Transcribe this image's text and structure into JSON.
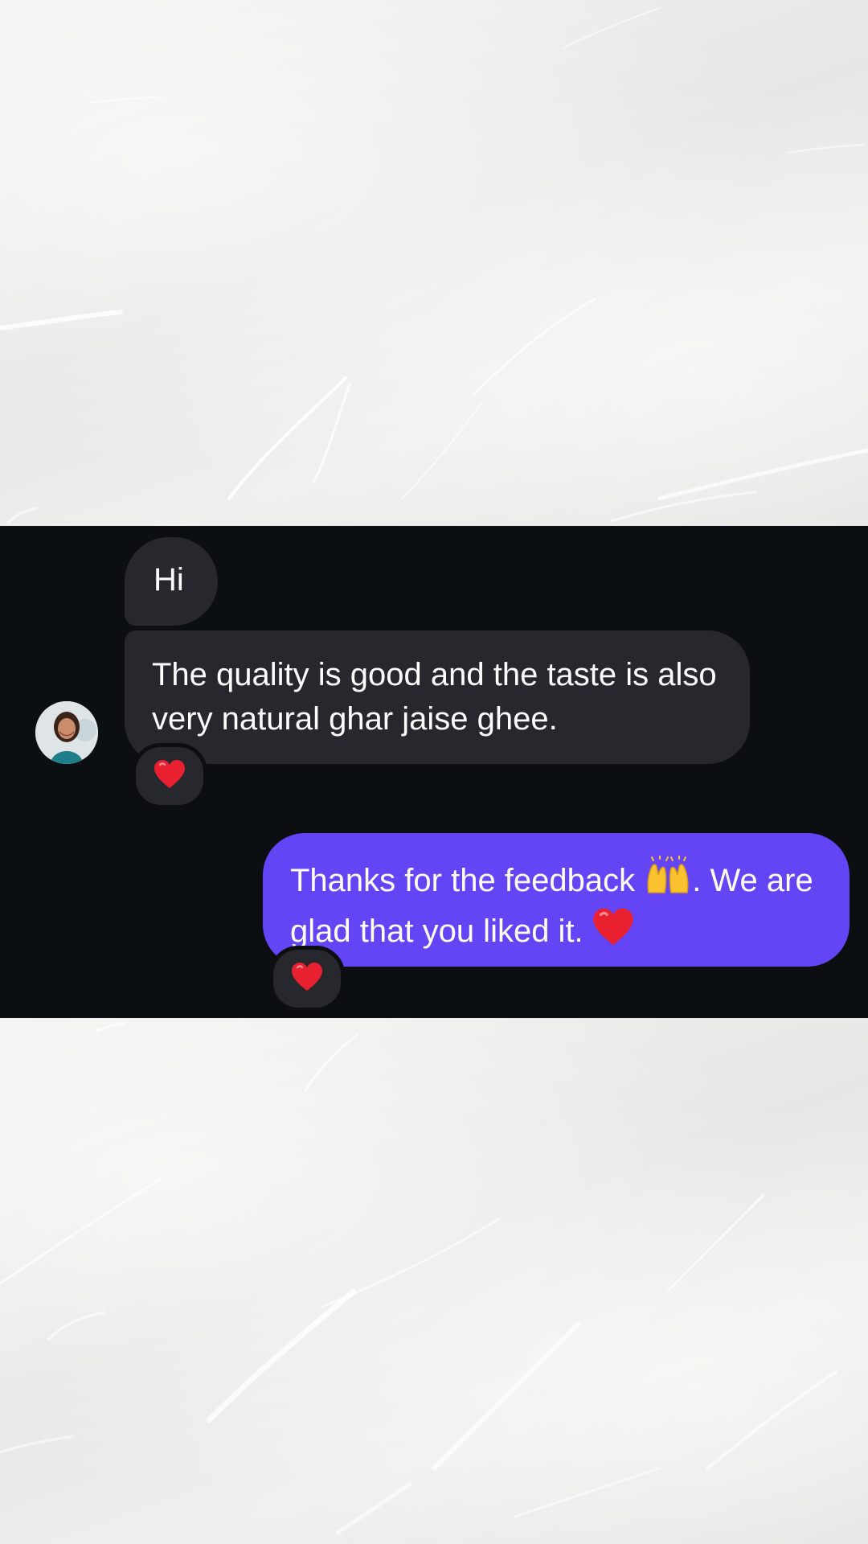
{
  "messages": {
    "incoming_1": {
      "text": "Hi"
    },
    "incoming_2": {
      "text": "The quality is good and the taste is also very natural ghar jaise ghee."
    },
    "outgoing_1": {
      "text_part1": "Thanks for the feedback ",
      "emoji_1": "raised-hands-icon",
      "text_part2": ". We are glad that you liked it. ",
      "emoji_2": "heart-icon"
    }
  },
  "reactions": {
    "incoming_2": "heart-icon",
    "outgoing_1": "heart-icon"
  },
  "colors": {
    "panel_background": "#0c0f12",
    "incoming_bubble": "#26282e",
    "outgoing_bubble": "#6345f5",
    "heart": "#e8202f"
  }
}
